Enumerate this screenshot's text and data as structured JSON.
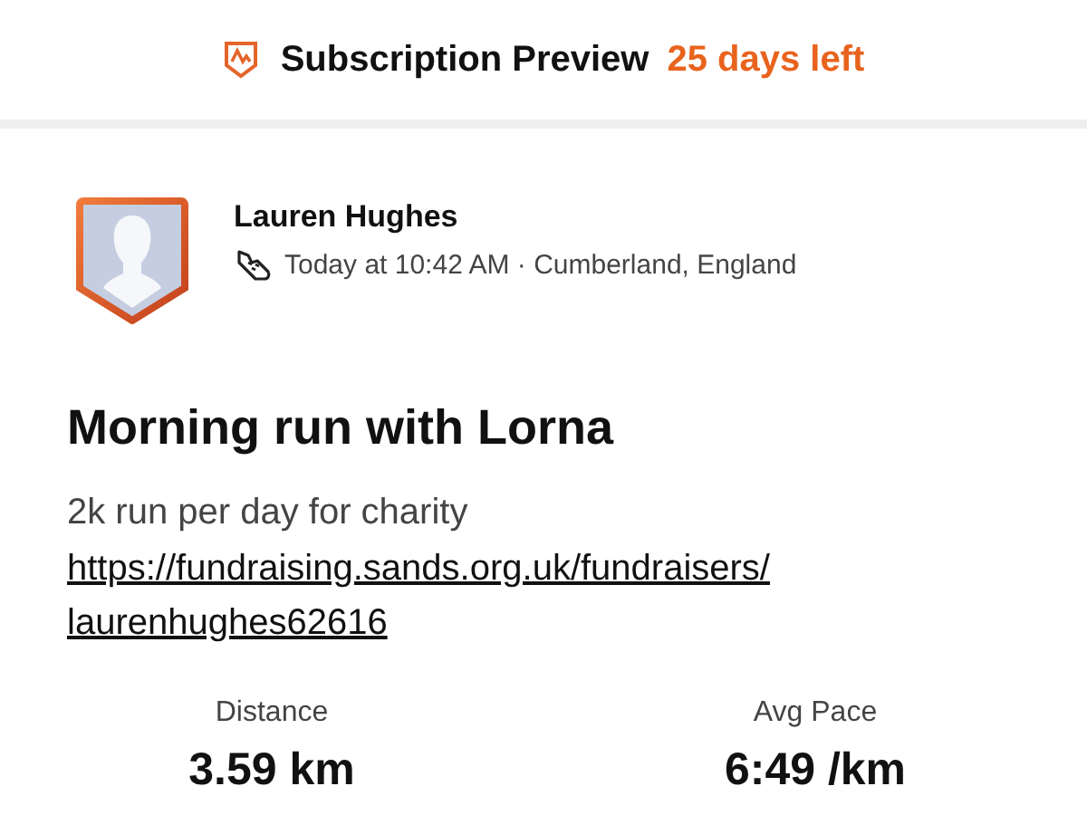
{
  "banner": {
    "title": "Subscription Preview",
    "countdown": "25 days left"
  },
  "athlete": {
    "name": "Lauren Hughes",
    "meta": "Today at 10:42 AM · Cumberland, England"
  },
  "activity": {
    "title": "Morning run with Lorna",
    "description": "2k run per day for charity",
    "link_lines": [
      "https://fundraising.sands.org.uk/fundraisers/",
      "laurenhughes62616"
    ]
  },
  "stats": [
    {
      "label": "Distance",
      "value": "3.59 km"
    },
    {
      "label": "Avg Pace",
      "value": "6:49 /km"
    }
  ]
}
